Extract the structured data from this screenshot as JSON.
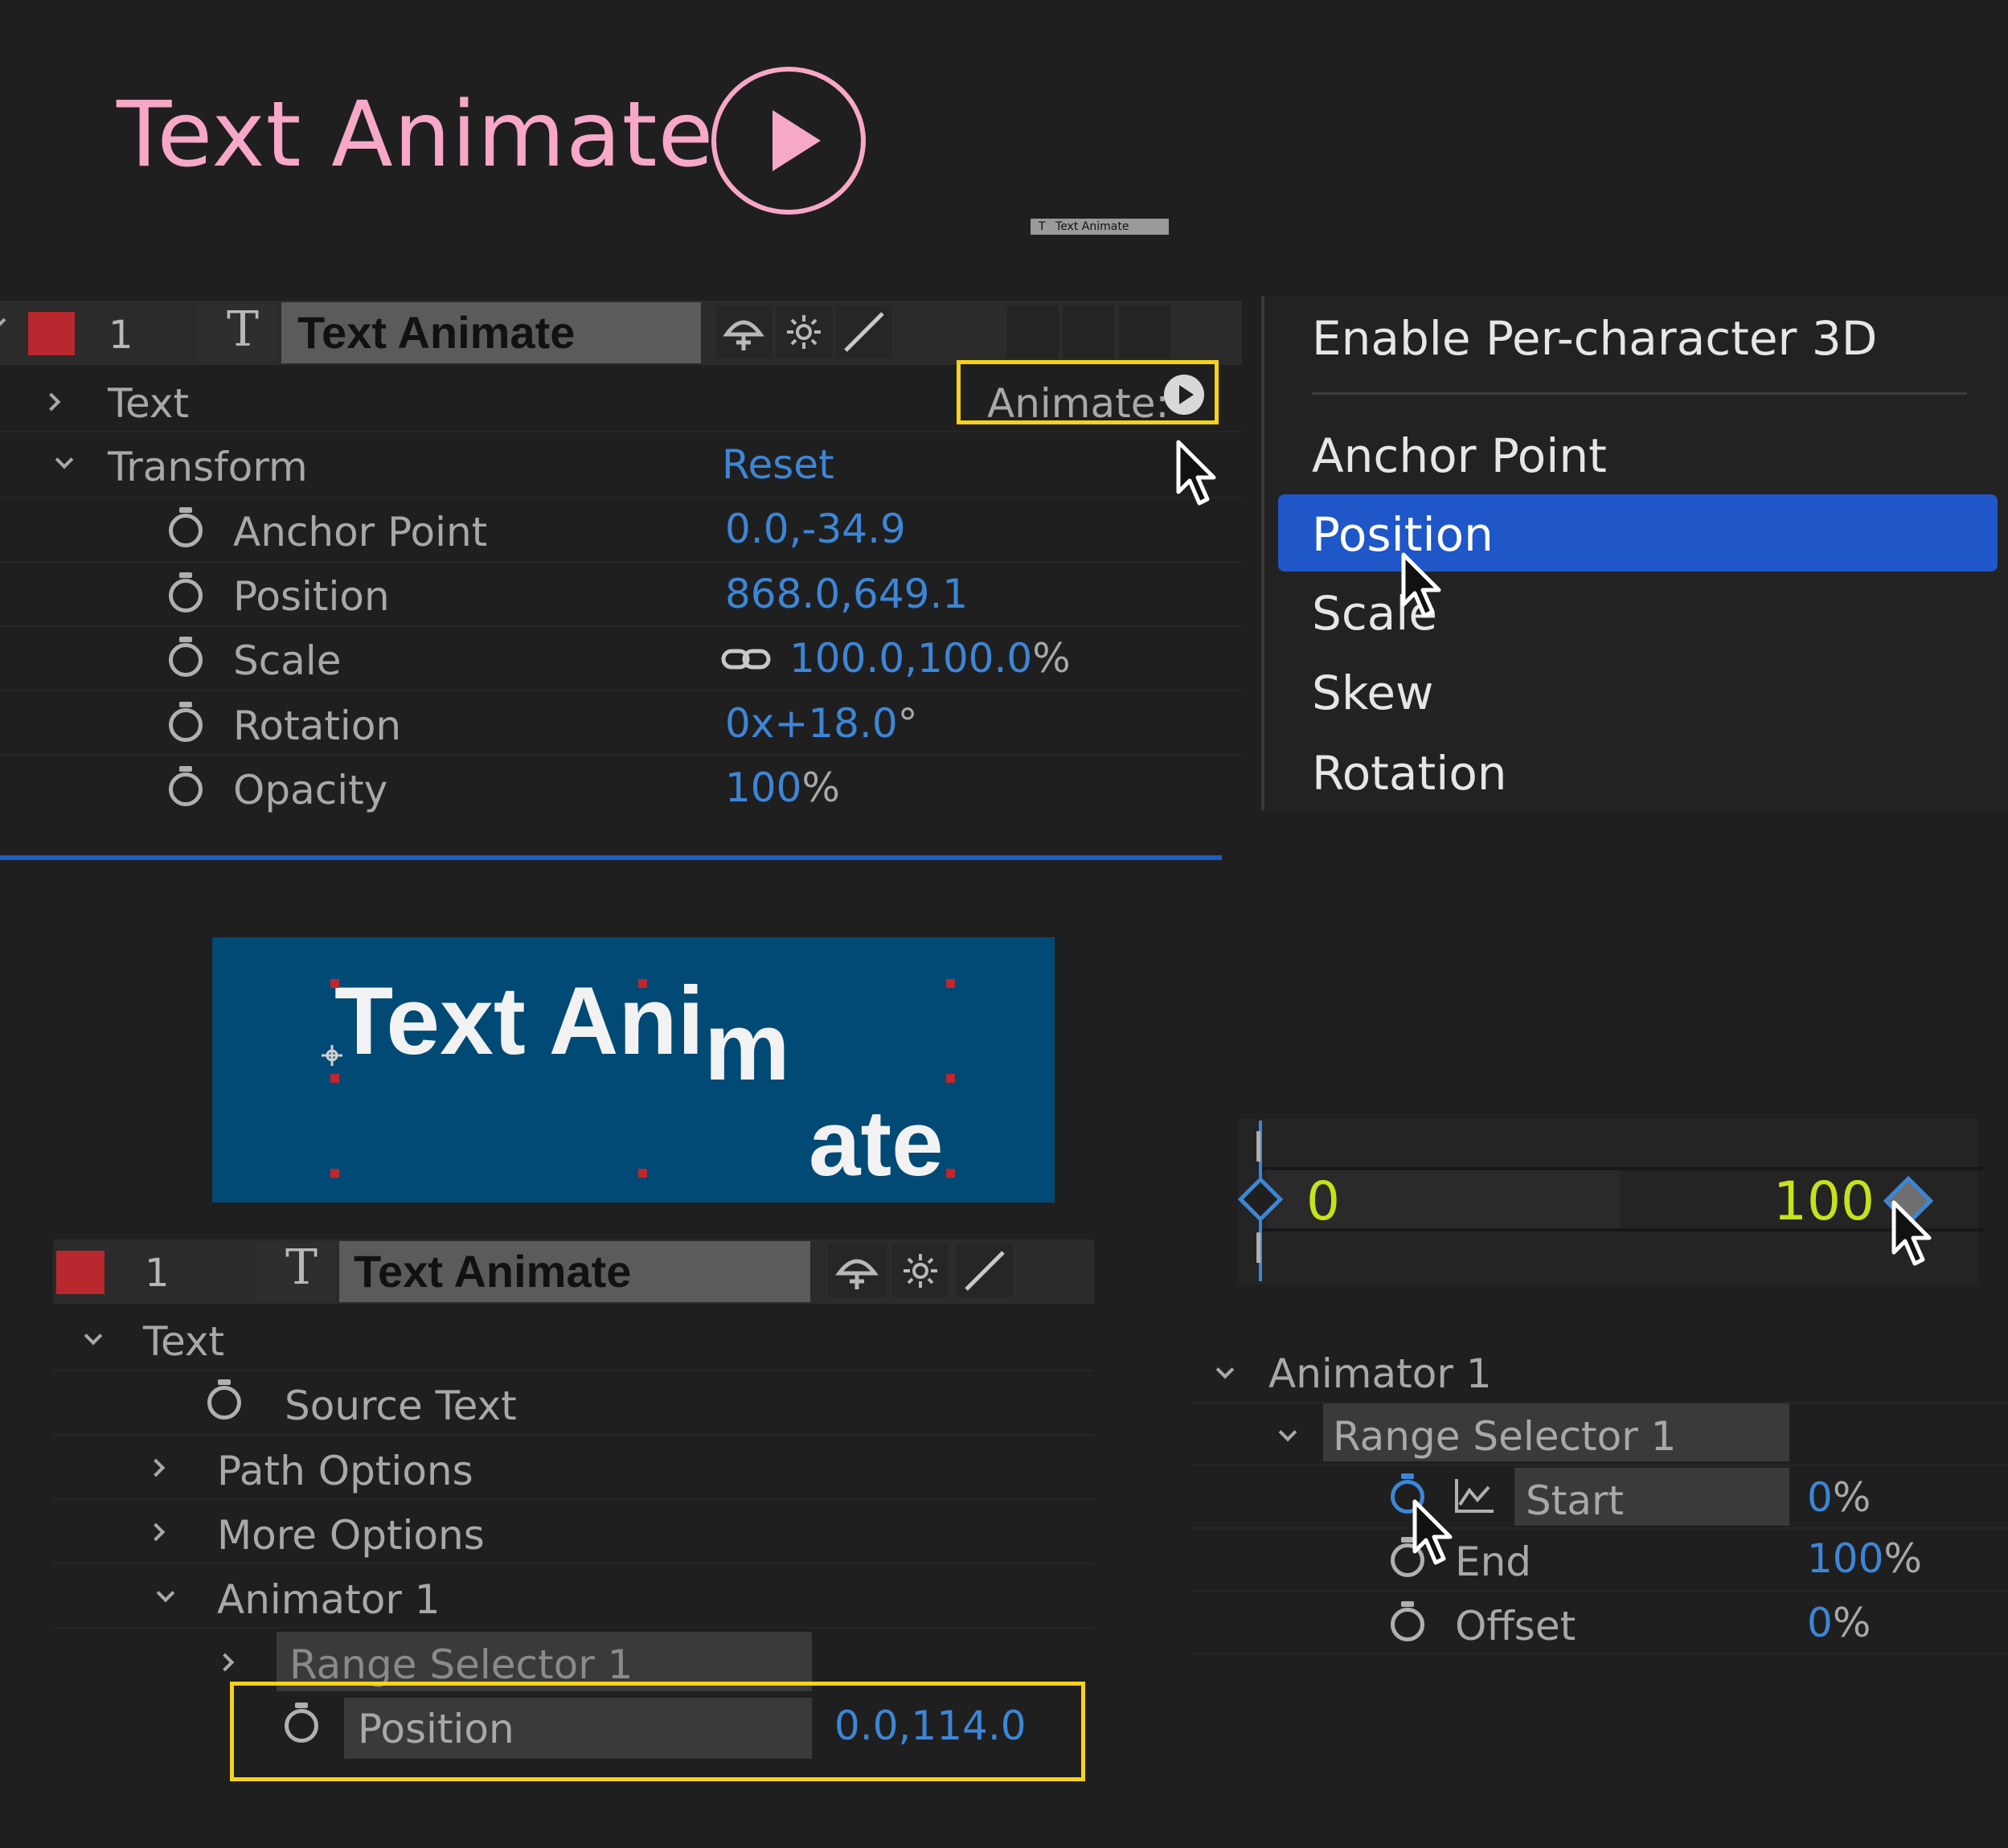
{
  "title": {
    "text": "Text Animate",
    "color": "#f7a7c8"
  },
  "play_icon": "play-circle-icon",
  "thumbnail_tab": {
    "icon": "T",
    "label": "Text Animate"
  },
  "top_timeline": {
    "layer_number": "1",
    "layer_type_icon": "T",
    "layer_name": "Text Animate",
    "text_group": "Text",
    "animate_label": "Animate:",
    "transform_group": "Transform",
    "reset_label": "Reset",
    "properties": [
      {
        "name": "Anchor Point",
        "value": "0.0,-34.9",
        "unit": ""
      },
      {
        "name": "Position",
        "value": "868.0,649.1",
        "unit": ""
      },
      {
        "name": "Scale",
        "value": "100.0,100.0",
        "unit": "%"
      },
      {
        "name": "Rotation",
        "value": "0x+18.0",
        "unit": "°"
      },
      {
        "name": "Opacity",
        "value": "100",
        "unit": "%"
      }
    ]
  },
  "animate_menu": {
    "header_item": "Enable Per-character 3D",
    "items": [
      {
        "label": "Anchor Point",
        "selected": false
      },
      {
        "label": "Position",
        "selected": true
      },
      {
        "label": "Scale",
        "selected": false
      },
      {
        "label": "Skew",
        "selected": false
      },
      {
        "label": "Rotation",
        "selected": false
      }
    ],
    "selected_color": "#1f56c8"
  },
  "preview": {
    "line1": "Text Ani",
    "line1_tail": "m",
    "line2": "ate",
    "background": "#014a75"
  },
  "range_scrubber": {
    "start_label": "0",
    "end_label": "100",
    "label_color": "#c8e21a"
  },
  "bottom_timeline": {
    "layer_number": "1",
    "layer_type_icon": "T",
    "layer_name": "Text Animate",
    "text_group": "Text",
    "source_text": "Source Text",
    "path_options": "Path Options",
    "more_options": "More Options",
    "animator": "Animator 1",
    "range_selector": "Range Selector 1",
    "position_label": "Position",
    "position_value": "0.0,114.0"
  },
  "animator_panel": {
    "animator": "Animator 1",
    "range_selector": "Range Selector 1",
    "rows": [
      {
        "name": "Start",
        "value": "0",
        "unit": "%"
      },
      {
        "name": "End",
        "value": "100",
        "unit": "%"
      },
      {
        "name": "Offset",
        "value": "0",
        "unit": "%"
      }
    ]
  },
  "highlight_color": "#f7d21a"
}
